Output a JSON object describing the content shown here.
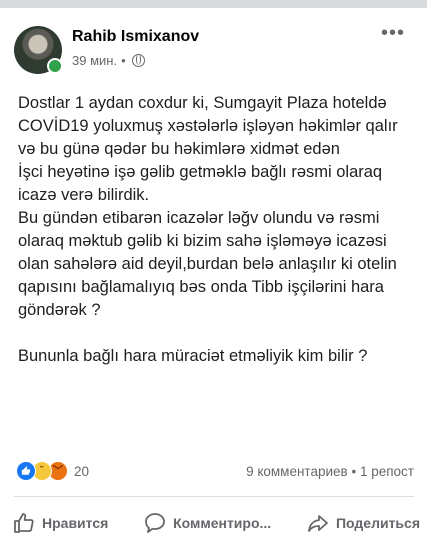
{
  "post": {
    "author": "Rahib Ismixanov",
    "time": "39 мин.",
    "separator": "•",
    "privacy_icon": "globe-icon",
    "body": [
      "Dostlar  1 aydan coxdur ki, Sumgayit Plaza hoteldə COVİD19 yoluxmuş xəstələrlə işləyən həkimlər qalır və bu günə qədər bu həkimlərə xidmət edən",
      "İşci heyətinə işə gəlib getməklə bağlı rəsmi olaraq icazə verə bilirdik.",
      "Bu gündən etibarən icazələr ləğv olundu və rəsmi olaraq məktub gəlib ki bizim sahə işləməyə icazəsi olan sahələrə aid deyil,burdan belə anlaşılır ki otelin qapısını bağlamalıyıq bəs onda Tibb işçilərini hara göndərək ?",
      " Bununla bağlı hara müraciət etməliyik kim bilir ?"
    ]
  },
  "stats": {
    "reaction_count": "20",
    "reactions": [
      "like",
      "sad",
      "angry"
    ],
    "comments": "9 комментариев",
    "dot": "•",
    "shares": "1 репост"
  },
  "actions": {
    "like": "Нравится",
    "comment": "Комментиро...",
    "share": "Поделиться"
  },
  "colors": {
    "like_blue": "#1877f2",
    "muted_text": "#65676b",
    "online_green": "#31a24c"
  }
}
